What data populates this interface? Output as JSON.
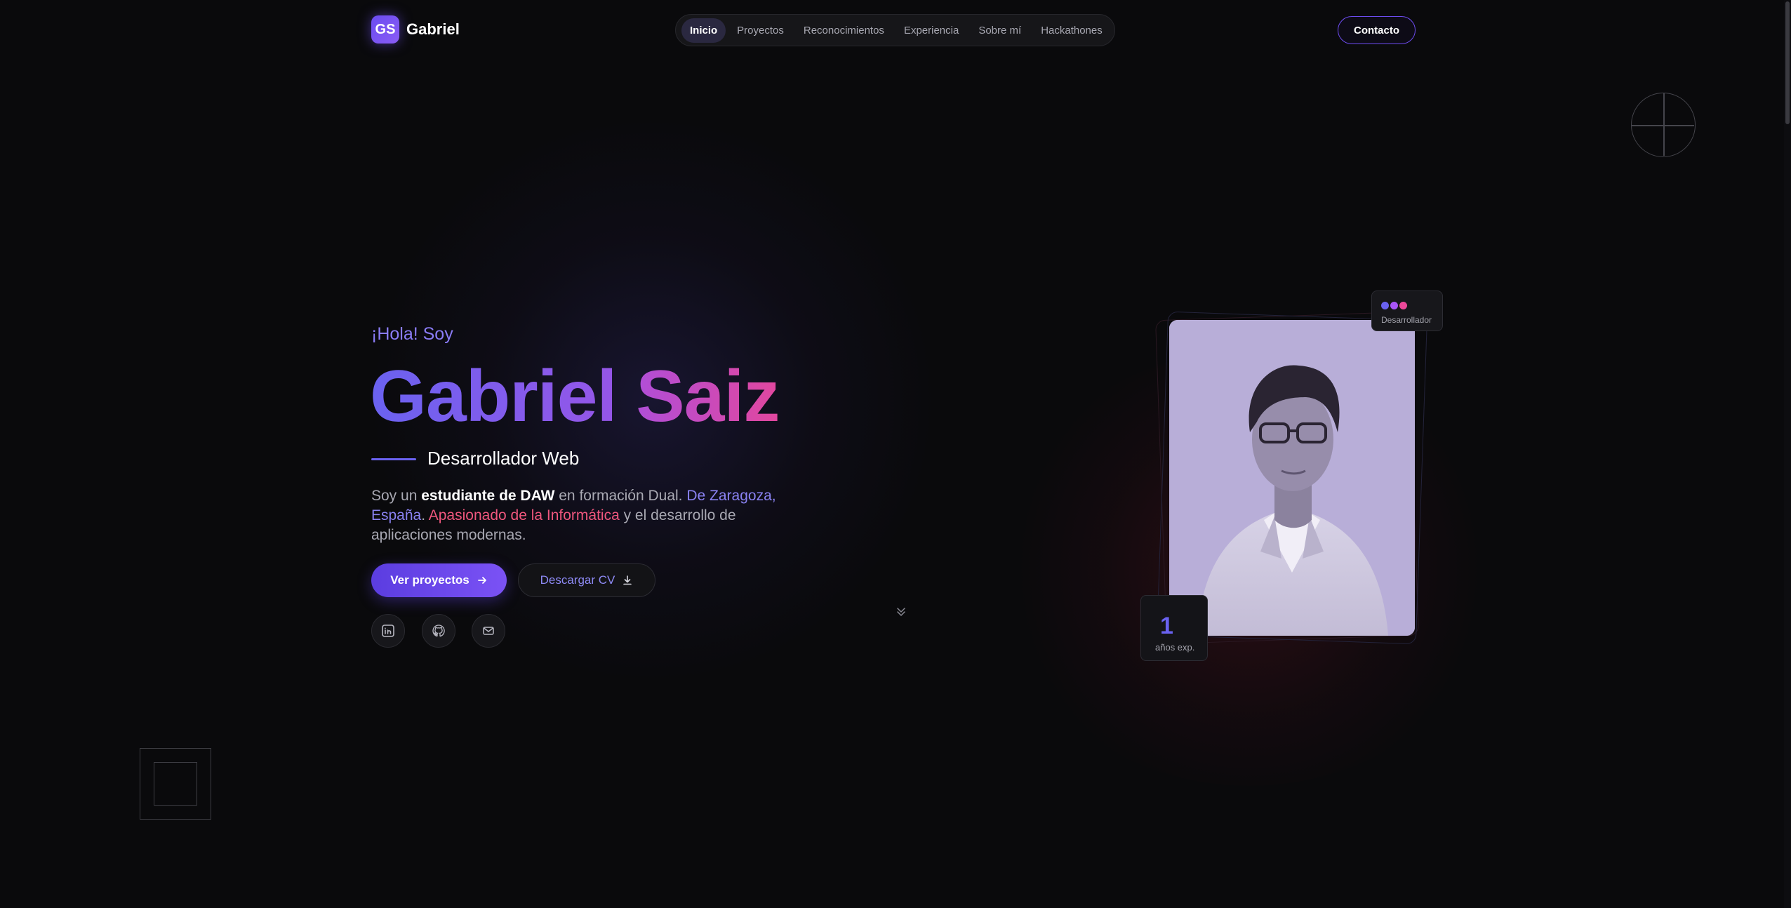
{
  "header": {
    "logo_initials": "GS",
    "logo_name": "Gabriel",
    "nav": [
      {
        "label": "Inicio",
        "active": true
      },
      {
        "label": "Proyectos",
        "active": false
      },
      {
        "label": "Reconocimientos",
        "active": false
      },
      {
        "label": "Experiencia",
        "active": false
      },
      {
        "label": "Sobre mí",
        "active": false
      },
      {
        "label": "Hackathones",
        "active": false
      }
    ],
    "contact_label": "Contacto"
  },
  "hero": {
    "greeting": "¡Hola! Soy",
    "first_name": "Gabriel",
    "last_name": "Saiz",
    "role": "Desarrollador Web",
    "bio": {
      "p1": "Soy un ",
      "strong": "estudiante de DAW",
      "p2": " en formación Dual. ",
      "place": "De Zaragoza, España",
      "p3": ". ",
      "passion": "Apasionado de la Informática",
      "p4": " y el desarrollo de aplicaciones modernas."
    },
    "primary_button": "Ver proyectos",
    "secondary_button": "Descargar CV",
    "socials": [
      {
        "icon": "linkedin-icon"
      },
      {
        "icon": "github-icon"
      },
      {
        "icon": "mail-icon"
      }
    ]
  },
  "profile": {
    "chip_label": "Desarrollador",
    "chip_dot_colors": [
      "#6a62f0",
      "#a855f7",
      "#ec4899"
    ],
    "experience_value": "1",
    "experience_label": "años exp."
  },
  "colors": {
    "accent": "#6a62f0",
    "accent_pink": "#e2479e",
    "background": "#0a0a0c"
  }
}
